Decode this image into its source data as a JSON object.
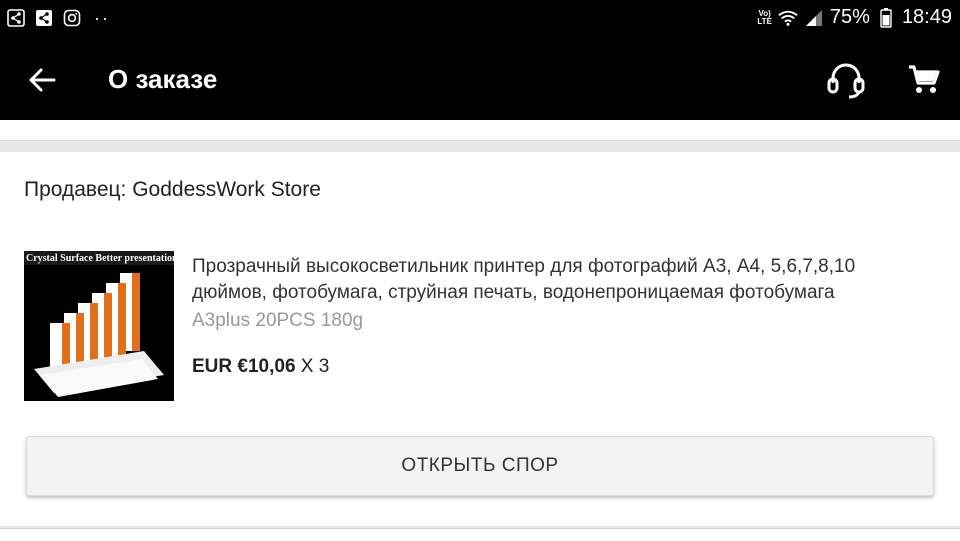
{
  "status_bar": {
    "left_icons": [
      "share-icon",
      "share-icon",
      "instagram-icon"
    ],
    "dots": "··",
    "network": "VoLTE",
    "battery": "75%",
    "time": "18:49"
  },
  "header": {
    "title": "О заказе",
    "icons": [
      "back-arrow-icon",
      "headset-icon",
      "cart-icon"
    ],
    "background": "#000000"
  },
  "order": {
    "seller": "Продавец: GoddessWork Store",
    "product": {
      "thumbnail_caption": "Crystal Surface  Better presentation",
      "title": "Прозрачный высокосветильник принтер для фотографий А3, А4, 5,6,7,8,10 дюймов, фотобумага, струйная печать, водонепроницаемая фотобумага",
      "variant": "A3plus  20PCS 180g",
      "price": "EUR €10,06",
      "quantity": "X 3"
    },
    "dispute_button": "ОТКРЫТЬ СПОР"
  },
  "colors": {
    "appbar": "#000000",
    "page_bg": "#e6e6e6",
    "variant_text": "#999999",
    "button_bg": "#f3f3f3"
  }
}
